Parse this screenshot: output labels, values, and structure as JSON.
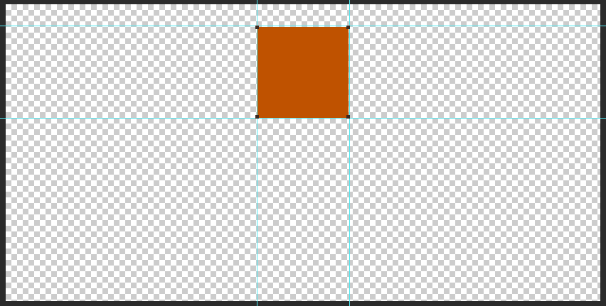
{
  "document": {
    "background": "transparent",
    "checker_light": "#ffffff",
    "checker_dark": "#cccccc"
  },
  "workspace": {
    "color": "#2b2b2b"
  },
  "layer": {
    "shape": "rounded-rectangle",
    "fill_color": "#bf5200",
    "selected": true
  },
  "guides": {
    "color": "#4ee6ee",
    "horizontal_count": 2,
    "vertical_count": 2
  },
  "anchor_points": {
    "color": "#3a2a22",
    "count": 4
  }
}
